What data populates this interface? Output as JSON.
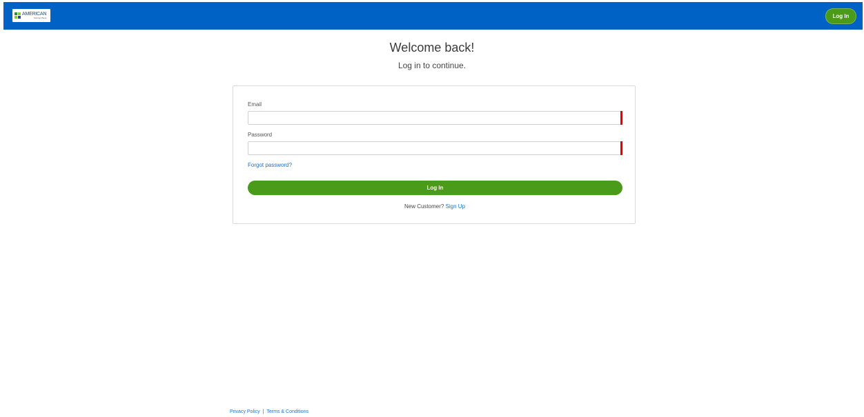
{
  "header": {
    "logo_text": "AMERICAN",
    "logo_subtext": "Savings Bank",
    "login_label": "Log In"
  },
  "main": {
    "title": "Welcome back!",
    "subtitle": "Log in to continue."
  },
  "form": {
    "email_label": "Email",
    "email_value": "",
    "password_label": "Password",
    "password_value": "",
    "forgot_label": "Forgot password?",
    "submit_label": "Log In",
    "new_customer_text": "New Customer?",
    "signup_label": "Sign Up"
  },
  "footer": {
    "privacy_label": "Privacy Policy",
    "separator": "|",
    "terms_label": "Terms & Conditions"
  },
  "colors": {
    "header_bg": "#0062c4",
    "accent_green": "#4a9b1a",
    "link_blue": "#1f6fc9",
    "error_red": "#e60000"
  }
}
